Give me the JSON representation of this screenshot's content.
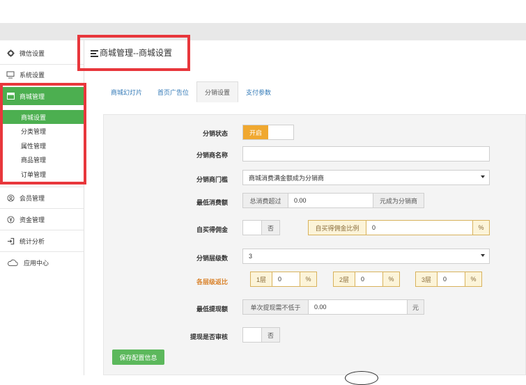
{
  "sidebar": {
    "items": [
      {
        "label": "微信设置",
        "icon": "gear-icon"
      },
      {
        "label": "系统设置",
        "icon": "monitor-icon"
      },
      {
        "label": "商城管理",
        "icon": "store-icon"
      },
      {
        "label": "会员管理",
        "icon": "user-circle-icon"
      },
      {
        "label": "资金管理",
        "icon": "yen-icon"
      },
      {
        "label": "统计分析",
        "icon": "sign-in-icon"
      },
      {
        "label": "应用中心",
        "icon": "cloud-icon"
      }
    ],
    "subitems": [
      {
        "label": "商城设置"
      },
      {
        "label": "分类管理"
      },
      {
        "label": "属性管理"
      },
      {
        "label": "商品管理"
      },
      {
        "label": "订单管理"
      }
    ]
  },
  "page": {
    "title": "商城管理--商城设置"
  },
  "tabs": [
    {
      "label": "商城幻灯片"
    },
    {
      "label": "首页广告位"
    },
    {
      "label": "分销设置"
    },
    {
      "label": "支付参数"
    }
  ],
  "form": {
    "status_label": "分销状态",
    "status_on": "开启",
    "name_label": "分销商名称",
    "name_value": "",
    "threshold_label": "分销商门槛",
    "threshold_value": "商城消费满金额成为分销商",
    "min_spend_label": "最低消费额",
    "min_spend_prefix": "总消费超过",
    "min_spend_value": "0.00",
    "min_spend_suffix": "元成为分销商",
    "self_comm_label": "自买得佣金",
    "self_comm_off": "否",
    "self_comm_ratio_label": "自买得佣金比例",
    "self_comm_ratio_value": "0",
    "self_comm_ratio_unit": "%",
    "levels_label": "分销层级数",
    "levels_value": "3",
    "rebate_label": "各层级返比",
    "rebate": [
      {
        "level": "1层",
        "value": "0",
        "unit": "%"
      },
      {
        "level": "2层",
        "value": "0",
        "unit": "%"
      },
      {
        "level": "3层",
        "value": "0",
        "unit": "%"
      }
    ],
    "min_withdraw_label": "最低提现额",
    "min_withdraw_prefix": "单次提现需不低于",
    "min_withdraw_value": "0.00",
    "min_withdraw_unit": "元",
    "withdraw_review_label": "提现是否审核",
    "withdraw_review_off": "否",
    "save_label": "保存配置信息"
  },
  "colors": {
    "accent_green": "#4caf50",
    "highlight_red": "#e8373c",
    "switch_orange": "#f0a830"
  }
}
